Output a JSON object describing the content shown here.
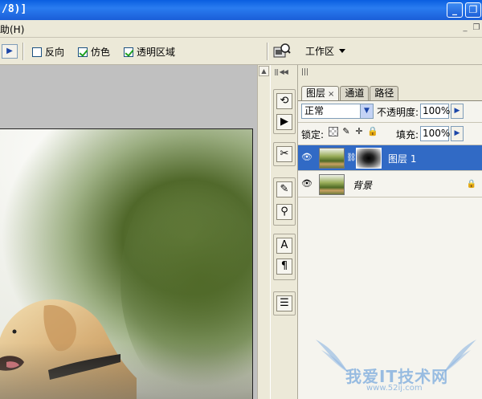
{
  "titlebar": {
    "title_fragment": "/8)]",
    "min_icon": "_",
    "restore_icon": "❐"
  },
  "menubar": {
    "help_label": "助(H)",
    "mini_min": "_",
    "mini_restore": "❐"
  },
  "options": {
    "invert_label": "反向",
    "invert_checked": false,
    "dither_label": "仿色",
    "dither_checked": true,
    "transparency_label": "透明区域",
    "transparency_checked": true,
    "workspace_label": "工作区"
  },
  "layers_panel": {
    "tabs": [
      {
        "label": "图层",
        "active": true,
        "close": "×"
      },
      {
        "label": "通道",
        "active": false
      },
      {
        "label": "路径",
        "active": false
      }
    ],
    "blend_mode": "正常",
    "opacity_label": "不透明度:",
    "opacity_value": "100%",
    "lock_label": "锁定:",
    "fill_label": "填充:",
    "fill_value": "100%",
    "layers": [
      {
        "name": "图层 1",
        "selected": true,
        "has_mask": true
      },
      {
        "name": "背景",
        "selected": false,
        "locked": true
      }
    ]
  },
  "watermark": {
    "text": "我爱IT技术网",
    "url": "www.52ij.com"
  },
  "colors": {
    "selection": "#316ac5",
    "titlebar": "#0a5fe0"
  }
}
